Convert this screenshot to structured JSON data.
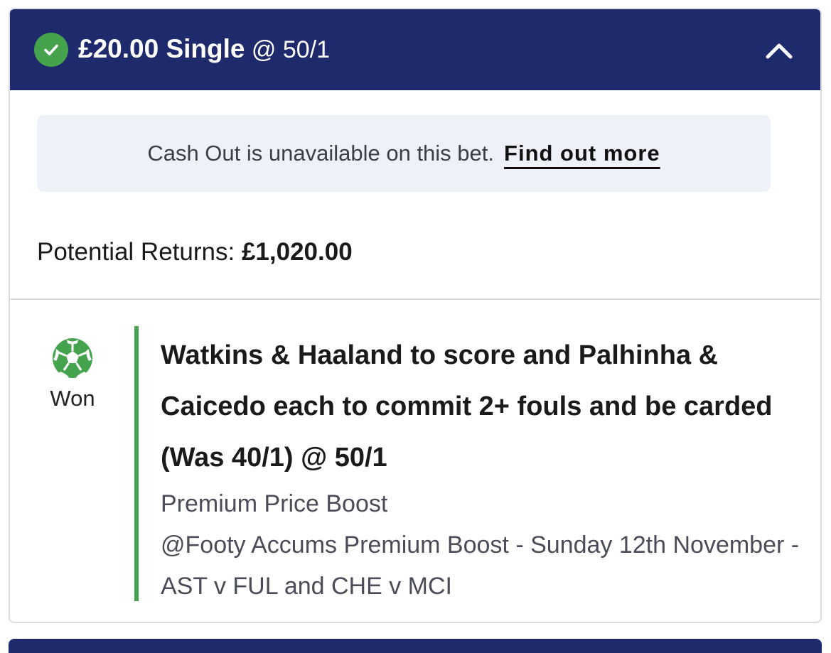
{
  "header": {
    "stake": "£20.00 Single",
    "odds": " @ 50/1",
    "status_icon": "check-circle-icon",
    "collapse_icon": "chevron-up-icon",
    "background_color": "#1e2a6b",
    "check_color": "#45a34e"
  },
  "cashout": {
    "message": "Cash Out is unavailable on this bet.",
    "link_label": "Find out more"
  },
  "returns": {
    "label": "Potential Returns:",
    "amount": "£1,020.00"
  },
  "selection": {
    "status_icon": "football-icon",
    "status_label": "Won",
    "status_color": "#45a34e",
    "title": "Watkins & Haaland to score and Palhinha & Caicedo each to commit 2+ fouls and be carded (Was 40/1) @ 50/1",
    "market": "Premium Price Boost",
    "event": "@Footy Accums Premium Boost - Sunday 12th November - AST v FUL and CHE v MCI"
  }
}
